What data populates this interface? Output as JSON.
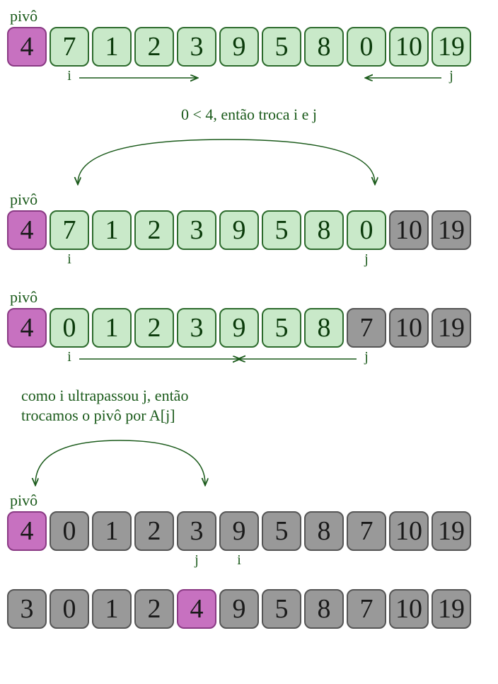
{
  "labels": {
    "pivot": "pivô",
    "i": "i",
    "j": "j"
  },
  "colors": {
    "pivot_fill": "#c771c0",
    "pivot_stroke": "#8a3a84",
    "green_fill": "#c9e9c9",
    "green_stroke": "#2d6b2d",
    "gray_fill": "#999999",
    "gray_stroke": "#555555",
    "text_green": "#1a5a1a"
  },
  "steps": [
    {
      "show_pivot_label": true,
      "row": [
        {
          "v": "4",
          "style": "pivot"
        },
        {
          "v": "7",
          "style": "green"
        },
        {
          "v": "1",
          "style": "green"
        },
        {
          "v": "2",
          "style": "green"
        },
        {
          "v": "3",
          "style": "green"
        },
        {
          "v": "9",
          "style": "green"
        },
        {
          "v": "5",
          "style": "green"
        },
        {
          "v": "8",
          "style": "green"
        },
        {
          "v": "0",
          "style": "green"
        },
        {
          "v": "10",
          "style": "green"
        },
        {
          "v": "19",
          "style": "green"
        }
      ],
      "pointers": {
        "i_index": 1,
        "j_index": 10
      },
      "arrows": {
        "left_from": 1,
        "left_to": 4,
        "right_from": 10,
        "right_to": 8
      }
    },
    {
      "note": "0 < 4, então troca i e j",
      "curve": {
        "from_index": 1,
        "to_index": 8,
        "height": 70
      },
      "show_pivot_label": true,
      "row": [
        {
          "v": "4",
          "style": "pivot"
        },
        {
          "v": "7",
          "style": "green"
        },
        {
          "v": "1",
          "style": "green"
        },
        {
          "v": "2",
          "style": "green"
        },
        {
          "v": "3",
          "style": "green"
        },
        {
          "v": "9",
          "style": "green"
        },
        {
          "v": "5",
          "style": "green"
        },
        {
          "v": "8",
          "style": "green"
        },
        {
          "v": "0",
          "style": "green"
        },
        {
          "v": "10",
          "style": "gray"
        },
        {
          "v": "19",
          "style": "gray"
        }
      ],
      "pointers": {
        "i_index": 1,
        "j_index": 8
      }
    },
    {
      "show_pivot_label": true,
      "row": [
        {
          "v": "4",
          "style": "pivot"
        },
        {
          "v": "0",
          "style": "green"
        },
        {
          "v": "1",
          "style": "green"
        },
        {
          "v": "2",
          "style": "green"
        },
        {
          "v": "3",
          "style": "green"
        },
        {
          "v": "9",
          "style": "green"
        },
        {
          "v": "5",
          "style": "green"
        },
        {
          "v": "8",
          "style": "green"
        },
        {
          "v": "7",
          "style": "gray"
        },
        {
          "v": "10",
          "style": "gray"
        },
        {
          "v": "19",
          "style": "gray"
        }
      ],
      "pointers": {
        "i_index": 1,
        "j_index": 8
      },
      "arrows": {
        "left_from": 1,
        "left_to": 5,
        "right_from": 8,
        "right_to": 5
      }
    },
    {
      "note": "como i ultrapassou j, então\ntrocamos o pivô por A[j]",
      "note_align": "left",
      "curve": {
        "from_index": 0,
        "to_index": 4,
        "height": 70
      },
      "show_pivot_label": true,
      "row": [
        {
          "v": "4",
          "style": "pivot"
        },
        {
          "v": "0",
          "style": "gray"
        },
        {
          "v": "1",
          "style": "gray"
        },
        {
          "v": "2",
          "style": "gray"
        },
        {
          "v": "3",
          "style": "gray"
        },
        {
          "v": "9",
          "style": "gray"
        },
        {
          "v": "5",
          "style": "gray"
        },
        {
          "v": "8",
          "style": "gray"
        },
        {
          "v": "7",
          "style": "gray"
        },
        {
          "v": "10",
          "style": "gray"
        },
        {
          "v": "19",
          "style": "gray"
        }
      ],
      "pointers": {
        "i_index": 5,
        "j_index": 4
      }
    },
    {
      "show_pivot_label": false,
      "row": [
        {
          "v": "3",
          "style": "gray"
        },
        {
          "v": "0",
          "style": "gray"
        },
        {
          "v": "1",
          "style": "gray"
        },
        {
          "v": "2",
          "style": "gray"
        },
        {
          "v": "4",
          "style": "pivot"
        },
        {
          "v": "9",
          "style": "gray"
        },
        {
          "v": "5",
          "style": "gray"
        },
        {
          "v": "8",
          "style": "gray"
        },
        {
          "v": "7",
          "style": "gray"
        },
        {
          "v": "10",
          "style": "gray"
        },
        {
          "v": "19",
          "style": "gray"
        }
      ]
    }
  ]
}
